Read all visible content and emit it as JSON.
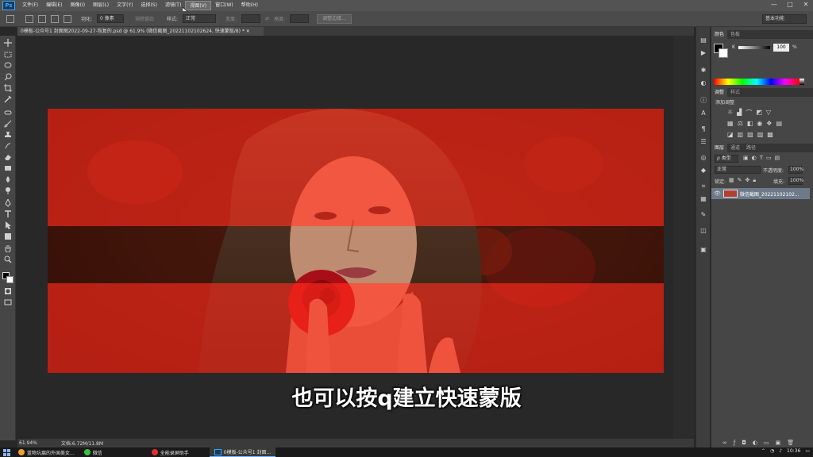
{
  "app": {
    "logo": "Ps"
  },
  "menu": [
    "文件(F)",
    "编辑(E)",
    "图像(I)",
    "图层(L)",
    "文字(Y)",
    "选择(S)",
    "滤镜(T)",
    "视图(V)",
    "窗口(W)",
    "帮助(H)"
  ],
  "window_controls": [
    "—",
    "□",
    "✕"
  ],
  "options_bar": {
    "feather_label": "羽化:",
    "feather_value": "0 像素",
    "antialias_label": "消除锯齿",
    "style_label": "样式:",
    "style_value": "正常",
    "width_label": "宽度:",
    "height_label": "高度:",
    "refine_button": "调整边缘...",
    "workspace": "基本功能"
  },
  "document_tab": {
    "title": "0模板-公众号1 封面图2022-09-27-恢复的.psd @ 61.9% (微信截图_20221102102624, 快速蒙版/8) * ✕"
  },
  "subtitle": "也可以按q建立快速蒙版",
  "status": {
    "zoom": "61.94%",
    "doc": "文档:6.72M/11.8M"
  },
  "color_panel": {
    "tabs": [
      "颜色",
      "色板"
    ],
    "channel_label": "K",
    "value": "100",
    "unit": "%"
  },
  "adjust_panel": {
    "tabs": [
      "调整",
      "样式"
    ],
    "title": "添加调整"
  },
  "layers_panel": {
    "tabs": [
      "图层",
      "通道",
      "路径"
    ],
    "filter_label": "ρ 类型",
    "blend_mode": "正常",
    "opacity_label": "不透明度:",
    "opacity_value": "100%",
    "lock_label": "锁定:",
    "fill_label": "填充:",
    "fill_value": "100%",
    "layer_name": "微信截图_20221102102..."
  },
  "taskbar": {
    "items": [
      {
        "label": "蓝物坑瘸的外国美女..."
      },
      {
        "label": "微信"
      },
      {
        "label": "全能录屏助手"
      },
      {
        "label": "0模板-公众号1 封面..."
      }
    ],
    "clock": "10:36"
  },
  "colors": {
    "accent": "#31a8ff",
    "mask_red": "#ff2a1a",
    "panel_bg": "#464646"
  }
}
